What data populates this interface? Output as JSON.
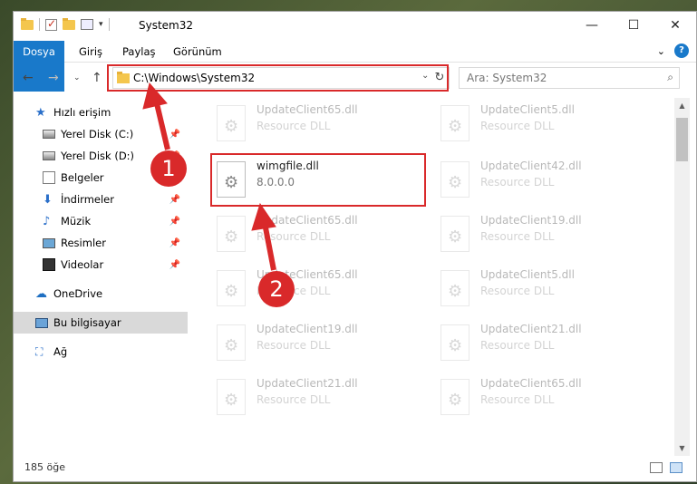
{
  "window": {
    "title": "System32"
  },
  "ribbon": {
    "tabs": [
      "Dosya",
      "Giriş",
      "Paylaş",
      "Görünüm"
    ]
  },
  "address": {
    "path": "C:\\Windows\\System32"
  },
  "search": {
    "placeholder": "Ara: System32"
  },
  "sidebar": {
    "items": [
      {
        "label": "Hızlı erişim",
        "icon": "star-icon"
      },
      {
        "label": "Yerel Disk (C:)",
        "icon": "drive-icon"
      },
      {
        "label": "Yerel Disk (D:)",
        "icon": "drive-icon"
      },
      {
        "label": "Belgeler",
        "icon": "document-icon"
      },
      {
        "label": "İndirmeler",
        "icon": "download-icon"
      },
      {
        "label": "Müzik",
        "icon": "music-icon"
      },
      {
        "label": "Resimler",
        "icon": "pictures-icon"
      },
      {
        "label": "Videolar",
        "icon": "video-icon"
      },
      {
        "label": "OneDrive",
        "icon": "cloud-icon"
      },
      {
        "label": "Bu bilgisayar",
        "icon": "computer-icon"
      },
      {
        "label": "Ağ",
        "icon": "network-icon"
      }
    ]
  },
  "files": {
    "highlighted": {
      "name": "wimgfile.dll",
      "detail": "8.0.0.0"
    },
    "left": [
      {
        "name": "UpdateClient65.dll",
        "type": "Resource DLL"
      },
      {
        "name": "UpdateClient65.dll",
        "type": "Resource DLL"
      },
      {
        "name": "UpdateClient65.dll",
        "type": "Resource DLL"
      },
      {
        "name": "UpdateClient19.dll",
        "type": "Resource DLL"
      },
      {
        "name": "UpdateClient21.dll",
        "type": "Resource DLL"
      }
    ],
    "right": [
      {
        "name": "UpdateClient5.dll",
        "type": "Resource DLL"
      },
      {
        "name": "UpdateClient42.dll",
        "type": "Resource DLL"
      },
      {
        "name": "UpdateClient19.dll",
        "type": "Resource DLL"
      },
      {
        "name": "UpdateClient5.dll",
        "type": "Resource DLL"
      },
      {
        "name": "UpdateClient21.dll",
        "type": "Resource DLL"
      },
      {
        "name": "UpdateClient65.dll",
        "type": "Resource DLL"
      }
    ]
  },
  "status": {
    "count": "185 öğe"
  },
  "annotations": {
    "step1": "1",
    "step2": "2"
  },
  "colors": {
    "accent": "#1979ca",
    "annotation": "#d9292a"
  }
}
